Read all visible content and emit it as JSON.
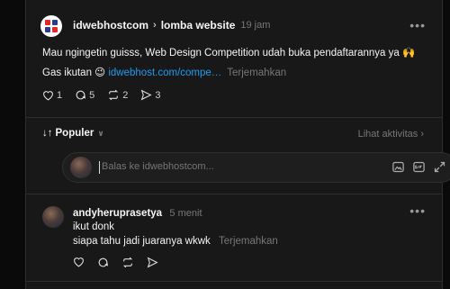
{
  "post": {
    "username": "idwebhostcom",
    "community": "lomba website",
    "time": "19 jam",
    "more": "•••",
    "text_line1": "Mau ngingetin guisss, Web Design Competition udah buka pendaftarannya ya 🙌",
    "text_line2_prefix": "Gas ikutan 😉 ",
    "link": "idwebhost.com/compe…",
    "translate": "Terjemahkan",
    "likes": "1",
    "comments": "5",
    "reposts": "2",
    "shares": "3"
  },
  "sort": {
    "label": "Populer",
    "activity_link": "Lihat aktivitas"
  },
  "reply": {
    "placeholder": "Balas ke idwebhostcom..."
  },
  "comment": {
    "username": "andyheruprasetya",
    "time": "5 menit",
    "more": "•••",
    "line1": "ikut donk",
    "line2": "siapa tahu jadi juaranya wkwk",
    "translate": "Terjemahkan"
  }
}
